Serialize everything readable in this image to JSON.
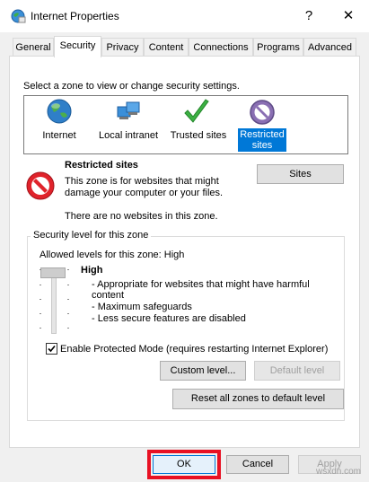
{
  "window": {
    "title": "Internet Properties",
    "help_label": "?",
    "close_label": "✕"
  },
  "tabs": [
    {
      "label": "General"
    },
    {
      "label": "Security"
    },
    {
      "label": "Privacy"
    },
    {
      "label": "Content"
    },
    {
      "label": "Connections"
    },
    {
      "label": "Programs"
    },
    {
      "label": "Advanced"
    }
  ],
  "active_tab": "Security",
  "zones": {
    "prompt": "Select a zone to view or change security settings.",
    "items": [
      {
        "label": "Internet",
        "icon": "globe-icon"
      },
      {
        "label": "Local intranet",
        "icon": "intranet-icon"
      },
      {
        "label": "Trusted sites",
        "icon": "checkmark-icon"
      },
      {
        "label_line1": "Restricted",
        "label_line2": "sites",
        "icon": "restricted-icon",
        "selected": true
      }
    ]
  },
  "zone_info": {
    "title": "Restricted sites",
    "description_line1": "This zone is for websites that might",
    "description_line2": "damage your computer or your files.",
    "status": "There are no websites in this zone.",
    "sites_button": "Sites"
  },
  "security_level": {
    "group_title": "Security level for this zone",
    "allowed": "Allowed levels for this zone: High",
    "level_name": "High",
    "bullets": [
      "- Appropriate for websites that might have harmful",
      "content",
      "- Maximum safeguards",
      "- Less secure features are disabled"
    ],
    "protected_mode_label": "Enable Protected Mode (requires restarting Internet Explorer)",
    "protected_mode_checked": true,
    "custom_level_button": "Custom level...",
    "default_level_button": "Default level"
  },
  "reset_button": "Reset all zones to default level",
  "footer": {
    "ok": "OK",
    "cancel": "Cancel",
    "apply": "Apply"
  },
  "colors": {
    "selection": "#0078d7",
    "highlight_box": "#e81123"
  },
  "watermark": "wsxdn.com"
}
